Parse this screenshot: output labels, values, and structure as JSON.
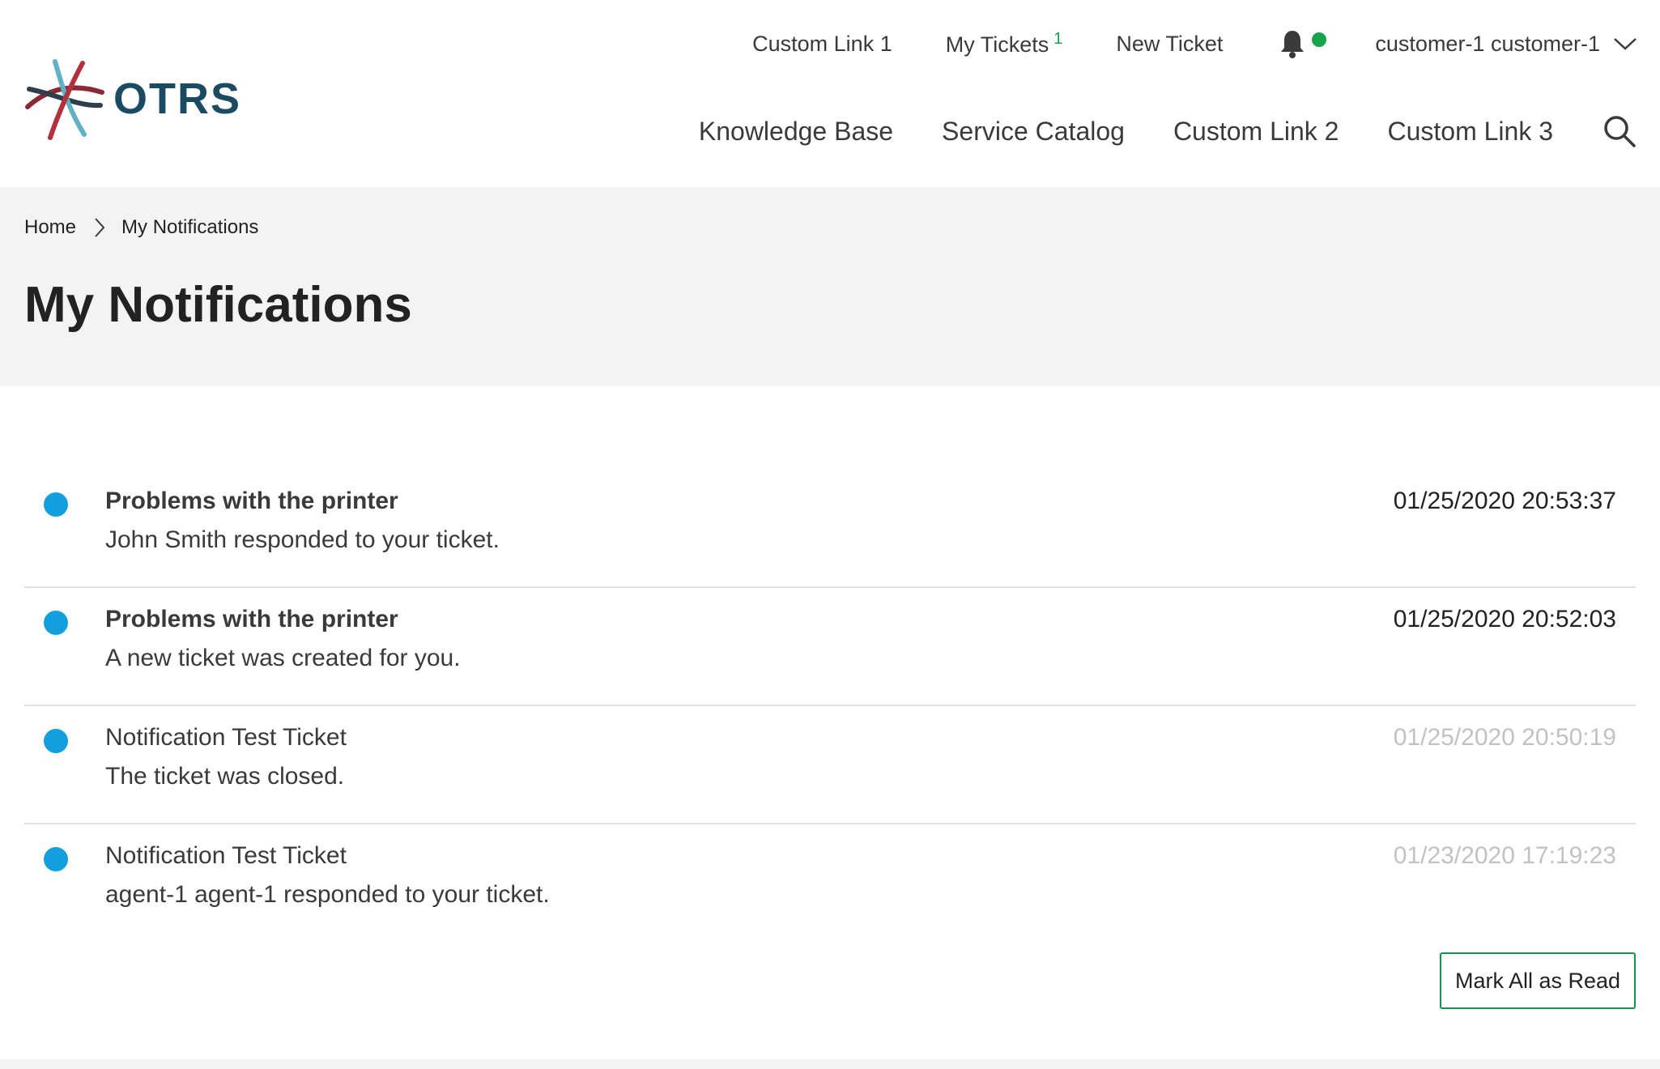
{
  "brand": {
    "name": "OTRS"
  },
  "topnav": {
    "custom_link_1": "Custom Link 1",
    "my_tickets": "My Tickets",
    "my_tickets_count": "1",
    "new_ticket": "New Ticket",
    "user": "customer-1 customer-1"
  },
  "mainnav": {
    "knowledge_base": "Knowledge Base",
    "service_catalog": "Service Catalog",
    "custom_link_2": "Custom Link 2",
    "custom_link_3": "Custom Link 3"
  },
  "breadcrumb": {
    "home": "Home",
    "current": "My Notifications"
  },
  "page": {
    "title": "My Notifications"
  },
  "notifications": [
    {
      "title": "Problems with the printer",
      "message": "John Smith responded to your ticket.",
      "time": "01/25/2020 20:53:37",
      "status": "unread"
    },
    {
      "title": "Problems with the printer",
      "message": "A new ticket was created for you.",
      "time": "01/25/2020 20:52:03",
      "status": "unread"
    },
    {
      "title": "Notification Test Ticket",
      "message": "The ticket was closed.",
      "time": "01/25/2020 20:50:19",
      "status": "read"
    },
    {
      "title": "Notification Test Ticket",
      "message": "agent-1 agent-1 responded to your ticket.",
      "time": "01/23/2020 17:19:23",
      "status": "read"
    }
  ],
  "actions": {
    "mark_all_read": "Mark All as Read"
  },
  "colors": {
    "accent_green": "#16a34a",
    "unread_dot": "#139fde",
    "brand_blue": "#1b4a63",
    "hero_bg": "#f3f3f3"
  },
  "icons": [
    "otrs-logo-icon",
    "bell-icon",
    "chevron-down-icon",
    "search-icon",
    "chevron-right-icon"
  ]
}
